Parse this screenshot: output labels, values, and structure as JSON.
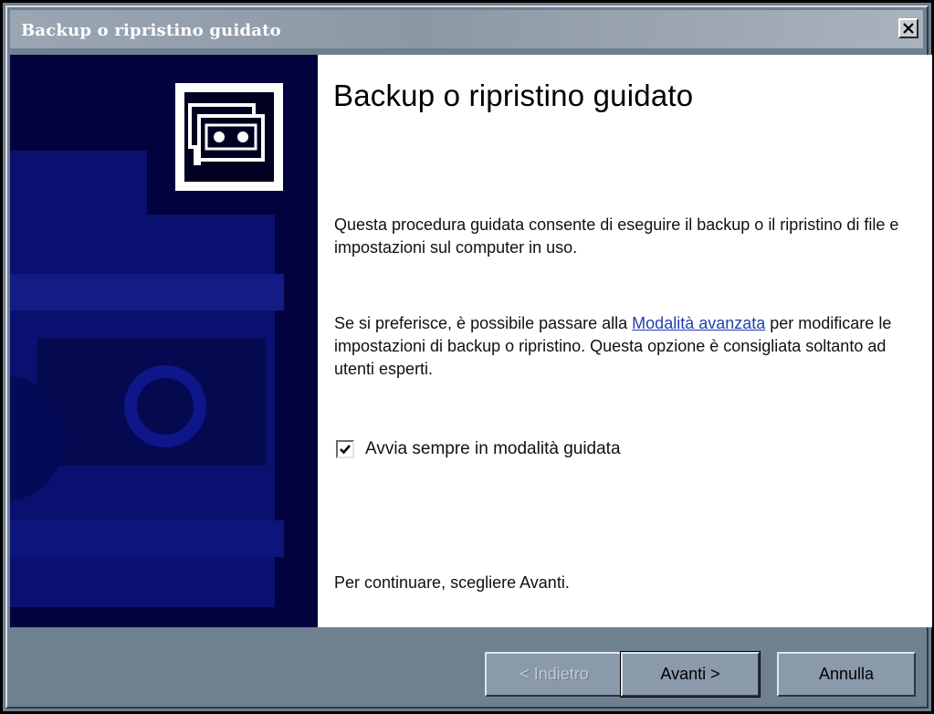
{
  "window": {
    "title": "Backup o ripristino guidato"
  },
  "main": {
    "heading": "Backup o ripristino guidato",
    "paragraph1": "Questa procedura guidata consente di eseguire il backup o il ripristino di file e impostazioni sul computer in uso.",
    "paragraph2_before": "Se si preferisce, è possibile passare alla ",
    "paragraph2_link": "Modalità avanzata",
    "paragraph2_after": " per modificare le impostazioni di backup o ripristino. Questa opzione è consigliata soltanto ad utenti esperti.",
    "checkbox_label": "Avvia sempre in modalità guidata",
    "checkbox_checked": true,
    "continue_text": "Per continuare, scegliere Avanti."
  },
  "buttons": {
    "back": "< Indietro",
    "next": "Avanti >",
    "cancel": "Annulla"
  },
  "colors": {
    "side_panel": "#02023f",
    "button_face": "#8a9aab",
    "link": "#1f3fb0"
  },
  "icons": {
    "close": "close-icon",
    "logo": "backup-tapes-icon",
    "checkmark": "checkmark-icon"
  }
}
